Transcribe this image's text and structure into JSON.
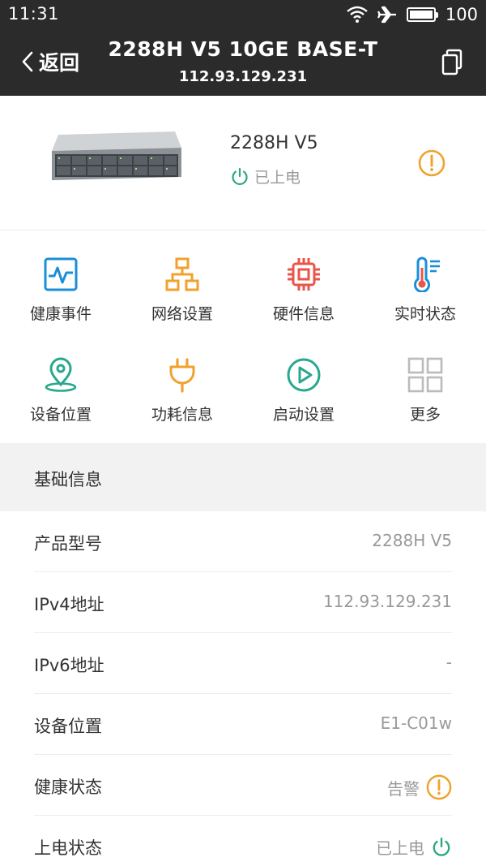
{
  "status_bar": {
    "time": "11:31",
    "battery": "100"
  },
  "header": {
    "back_label": "返回",
    "title": "2288H V5 10GE BASE-T",
    "subtitle": "112.93.129.231"
  },
  "device": {
    "model": "2288H V5",
    "power_status": "已上电"
  },
  "menu": [
    {
      "label": "健康事件",
      "icon": "health-event-icon"
    },
    {
      "label": "网络设置",
      "icon": "network-settings-icon"
    },
    {
      "label": "硬件信息",
      "icon": "hardware-chip-icon"
    },
    {
      "label": "实时状态",
      "icon": "thermometer-icon"
    },
    {
      "label": "设备位置",
      "icon": "location-pin-icon"
    },
    {
      "label": "功耗信息",
      "icon": "power-plug-icon"
    },
    {
      "label": "启动设置",
      "icon": "play-circle-icon"
    },
    {
      "label": "更多",
      "icon": "more-grid-icon"
    }
  ],
  "basic_info": {
    "title": "基础信息",
    "rows": [
      {
        "key": "产品型号",
        "value": "2288H V5"
      },
      {
        "key": "IPv4地址",
        "value": "112.93.129.231"
      },
      {
        "key": "IPv6地址",
        "value": "-"
      },
      {
        "key": "设备位置",
        "value": "E1-C01w"
      },
      {
        "key": "健康状态",
        "value": "告警"
      },
      {
        "key": "上电状态",
        "value": "已上电"
      }
    ]
  },
  "colors": {
    "header_bg": "#2b2b2b",
    "blue": "#1a8fd8",
    "orange": "#f0a22e",
    "red": "#e8564a",
    "green": "#29a88e",
    "gray": "#999999",
    "alert": "#f0a22e",
    "power_green": "#2fa87e"
  }
}
